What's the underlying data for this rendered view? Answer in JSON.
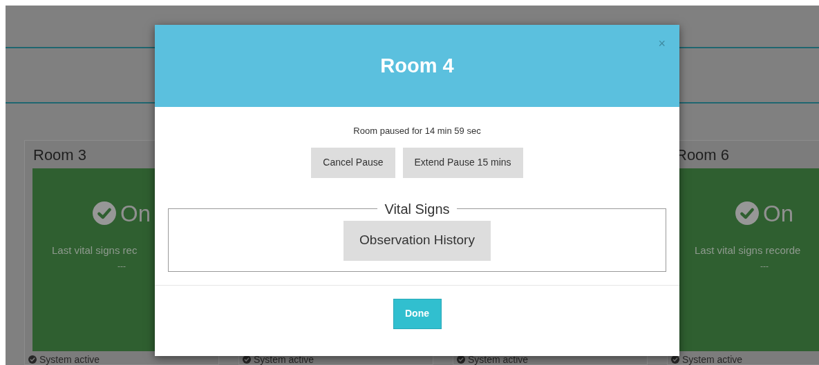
{
  "rooms": [
    {
      "title": "Room 3",
      "status": "On",
      "last_vitals": "Last vital signs rec",
      "vitals_value": "---",
      "footer": "System active"
    },
    {
      "footer": "System active"
    },
    {
      "footer": "System active"
    },
    {
      "title": "Room 6",
      "status": "On",
      "last_vitals": "Last vital signs recorde",
      "vitals_value": "---",
      "footer": "System active"
    }
  ],
  "modal": {
    "title": "Room 4",
    "close": "×",
    "pause_message": "Room paused for 14 min 59 sec",
    "buttons": [
      "Cancel Pause",
      "Extend Pause 15 mins"
    ],
    "fieldset": {
      "legend": "Vital Signs",
      "button": "Observation History"
    },
    "done": "Done"
  }
}
